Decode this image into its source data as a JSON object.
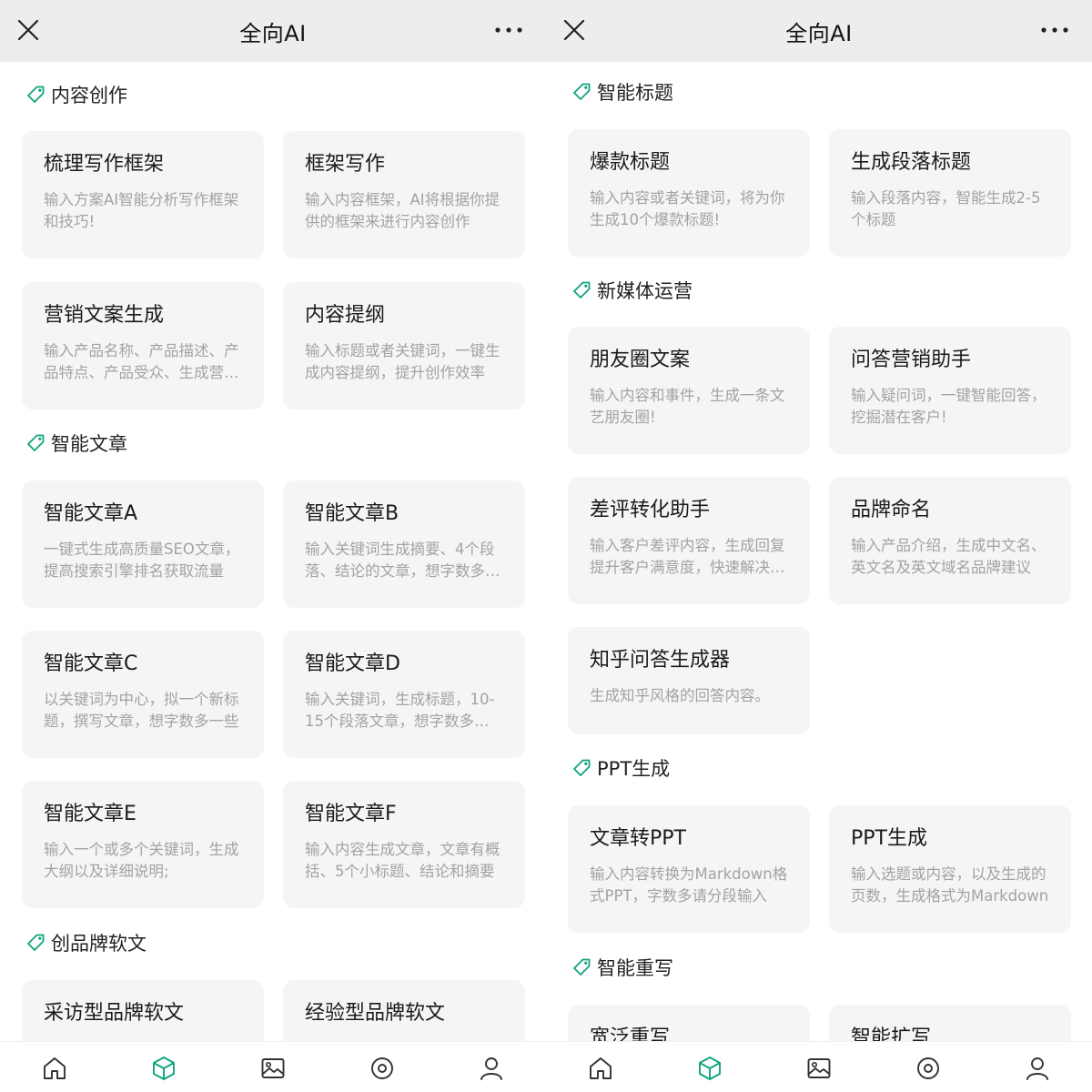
{
  "colors": {
    "accent": "#10a37f",
    "icon": "#333333",
    "card_bg": "#f4f5f5",
    "desc": "#a3a3a3"
  },
  "left": {
    "topbar": {
      "title": "全向AI",
      "close_icon": "close-icon",
      "more_icon": "more-icon"
    },
    "sections": [
      {
        "label": "内容创作",
        "cards": [
          {
            "title": "梳理写作框架",
            "desc": "输入方案AI智能分析写作框架和技巧!"
          },
          {
            "title": "框架写作",
            "desc": "输入内容框架，AI将根据你提供的框架来进行内容创作"
          },
          {
            "title": "营销文案生成",
            "desc": "输入产品名称、产品描述、产品特点、产品受众、生成营销文案"
          },
          {
            "title": "内容提纲",
            "desc": "输入标题或者关键词，一键生成内容提纲，提升创作效率"
          }
        ]
      },
      {
        "label": "智能文章",
        "cards": [
          {
            "title": "智能文章A",
            "desc": "一键式生成高质量SEO文章，提高搜索引擎排名获取流量"
          },
          {
            "title": "智能文章B",
            "desc": "输入关键词生成摘要、4个段落、结论的文章，想字数多一些"
          },
          {
            "title": "智能文章C",
            "desc": "以关键词为中心，拟一个新标题，撰写文章，想字数多一些"
          },
          {
            "title": "智能文章D",
            "desc": "输入关键词，生成标题，10-15个段落文章，想字数多一些"
          },
          {
            "title": "智能文章E",
            "desc": "输入一个或多个关键词，生成大纲以及详细说明;"
          },
          {
            "title": "智能文章F",
            "desc": "输入内容生成文章，文章有概括、5个小标题、结论和摘要"
          }
        ]
      },
      {
        "label": "创品牌软文",
        "cards": [
          {
            "title": "采访型品牌软文",
            "desc": ""
          },
          {
            "title": "经验型品牌软文",
            "desc": ""
          }
        ]
      }
    ]
  },
  "right": {
    "topbar": {
      "title": "全向AI",
      "close_icon": "close-icon",
      "more_icon": "more-icon"
    },
    "sections": [
      {
        "label": "智能标题",
        "cards": [
          {
            "title": "爆款标题",
            "desc": "输入内容或者关键词，将为你生成10个爆款标题!"
          },
          {
            "title": "生成段落标题",
            "desc": "输入段落内容，智能生成2-5个标题"
          }
        ]
      },
      {
        "label": "新媒体运营",
        "cards": [
          {
            "title": "朋友圈文案",
            "desc": "输入内容和事件，生成一条文艺朋友圈!"
          },
          {
            "title": "问答营销助手",
            "desc": "输入疑问词，一键智能回答，挖掘潜在客户!"
          },
          {
            "title": "差评转化助手",
            "desc": "输入客户差评内容，生成回复提升客户满意度，快速解决问题"
          },
          {
            "title": "品牌命名",
            "desc": "输入产品介绍，生成中文名、英文名及英文域名品牌建议"
          },
          {
            "title": "知乎问答生成器",
            "desc": "生成知乎风格的回答内容。"
          }
        ]
      },
      {
        "label": "PPT生成",
        "cards": [
          {
            "title": "文章转PPT",
            "desc": "输入内容转换为Markdown格式PPT，字数多请分段输入"
          },
          {
            "title": "PPT生成",
            "desc": "输入选题或内容，以及生成的页数，生成格式为Markdown"
          }
        ]
      },
      {
        "label": "智能重写",
        "cards": [
          {
            "title": "宽泛重写",
            "desc": ""
          },
          {
            "title": "智能扩写",
            "desc": ""
          }
        ]
      }
    ]
  },
  "tabbar": {
    "items": [
      {
        "icon": "home-icon"
      },
      {
        "icon": "cube-icon",
        "active": true
      },
      {
        "icon": "image-icon"
      },
      {
        "icon": "compass-icon"
      },
      {
        "icon": "user-icon"
      }
    ]
  }
}
